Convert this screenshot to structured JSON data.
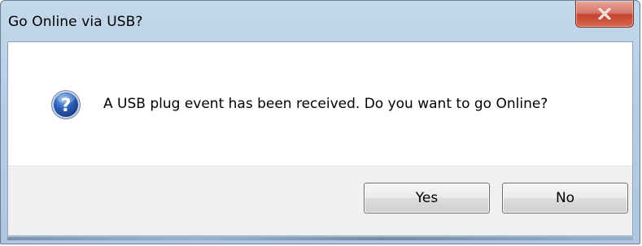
{
  "window": {
    "title": "Go Online via USB?"
  },
  "dialog": {
    "message": "A USB plug event has been received. Do you want to go Online?",
    "icon": "question-icon"
  },
  "buttons": {
    "yes_label": "Yes",
    "no_label": "No",
    "close_icon": "close-icon"
  },
  "colors": {
    "close_button": "#c4432f",
    "icon_blue": "#2d5fb8",
    "footer_bg": "#f0f0f0"
  }
}
